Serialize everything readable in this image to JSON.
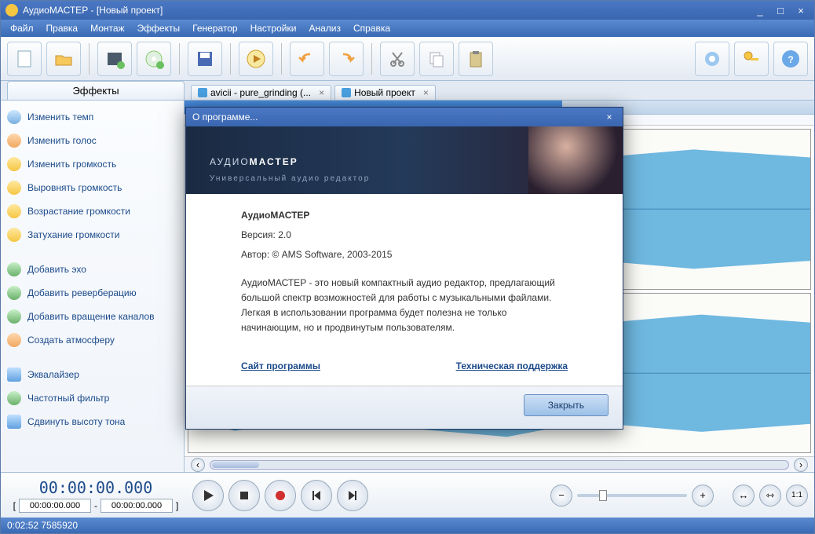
{
  "window": {
    "title": "АудиоМАСТЕР - [Новый проект]"
  },
  "menu": {
    "items": [
      "Файл",
      "Правка",
      "Монтаж",
      "Эффекты",
      "Генератор",
      "Настройки",
      "Анализ",
      "Справка"
    ]
  },
  "tabs": {
    "effects_header": "Эффекты",
    "files": [
      {
        "label": "avicii - pure_grinding (..."
      },
      {
        "label": "Новый проект"
      }
    ]
  },
  "effects": [
    {
      "label": "Изменить темп",
      "icon": "#7aaee0"
    },
    {
      "label": "Изменить голос",
      "icon": "#f0a860"
    },
    {
      "label": "Изменить громкость",
      "icon": "#f5c642"
    },
    {
      "label": "Выровнять громкость",
      "icon": "#f5c642"
    },
    {
      "label": "Возрастание громкости",
      "icon": "#f5c642"
    },
    {
      "label": "Затухание громкости",
      "icon": "#f5c642"
    }
  ],
  "effects2": [
    {
      "label": "Добавить эхо",
      "icon": "#6ab06a"
    },
    {
      "label": "Добавить реверберацию",
      "icon": "#6ab06a"
    },
    {
      "label": "Добавить вращение каналов",
      "icon": "#6ab06a"
    },
    {
      "label": "Создать атмосферу",
      "icon": "#f0a860"
    }
  ],
  "effects3": [
    {
      "label": "Эквалайзер",
      "icon": "#60a0e0"
    },
    {
      "label": "Частотный фильтр",
      "icon": "#6ab06a"
    },
    {
      "label": "Сдвинуть высоту тона",
      "icon": "#60a0e0"
    }
  ],
  "transport": {
    "big_time": "00:00:00.000",
    "sel_start": "00:00:00.000",
    "sel_end": "00:00:00.000",
    "dash": "-"
  },
  "status": {
    "text": "0:02:52 7585920"
  },
  "dialog": {
    "title": "О программе...",
    "banner_main": "АУДИО",
    "banner_bold": "МАСТЕР",
    "banner_sub": "Универсальный аудио редактор",
    "name": "АудиоМАСТЕР",
    "version_label": "Версия: 2.0",
    "author_label": "Автор: © AMS Software, 2003-2015",
    "description": "АудиоМАСТЕР - это новый компактный аудио редактор, предлагающий большой спектр возможностей для работы с музыкальными файлами. Легкая в использовании программа будет полезна не только начинающим, но и продвинутым пользователям.",
    "link_site": "Сайт программы",
    "link_support": "Техническая поддержка",
    "close_btn": "Закрыть"
  },
  "brackets": {
    "open": "[",
    "close": "]"
  }
}
